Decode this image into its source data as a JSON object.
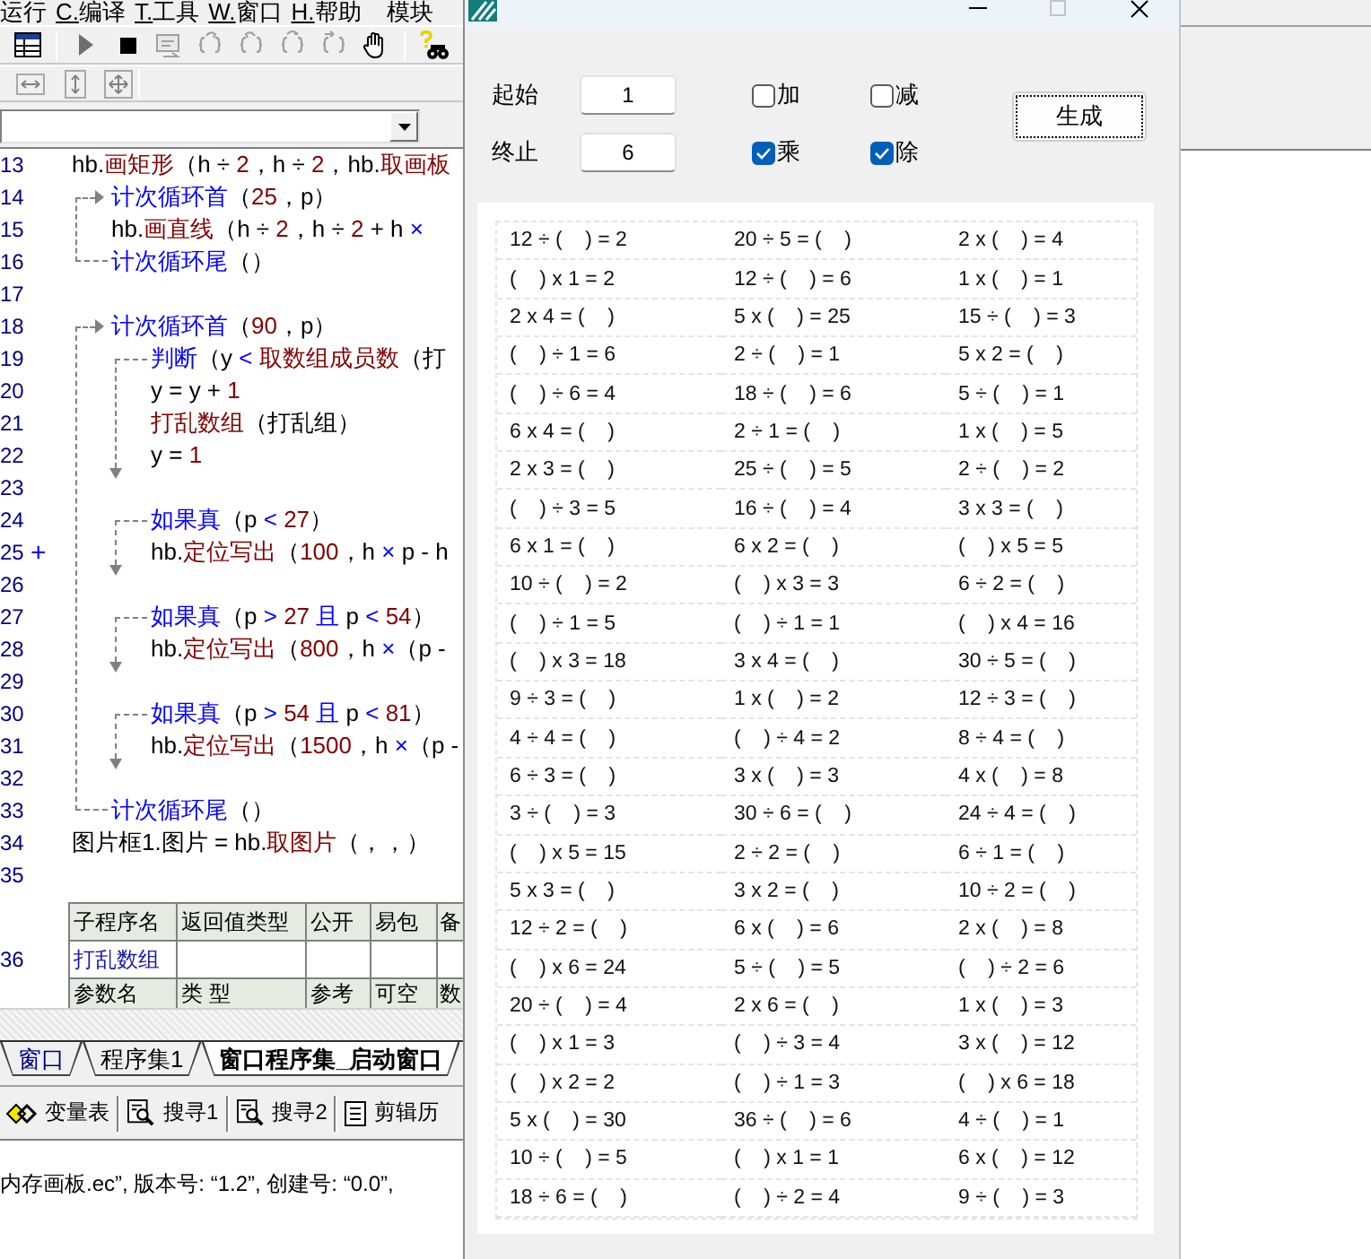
{
  "ide": {
    "menu": [
      {
        "label": "运行",
        "mnemonic": false
      },
      {
        "label": "C.编译",
        "mnemonic": true
      },
      {
        "label": "T.工具",
        "mnemonic": true
      },
      {
        "label": "W.窗口",
        "mnemonic": true
      },
      {
        "label": "H.帮助",
        "mnemonic": true
      },
      {
        "label": "模块",
        "mnemonic": false
      }
    ],
    "code": [
      {
        "kind": "line",
        "number": "13",
        "tokens": [
          {
            "text": "hb.",
            "kind": "plain"
          },
          {
            "text": "画矩形",
            "kind": "command"
          },
          {
            "text": "（h ÷ ",
            "kind": "plain"
          },
          {
            "text": "2",
            "kind": "number"
          },
          {
            "text": "，h ÷ ",
            "kind": "plain"
          },
          {
            "text": "2",
            "kind": "number"
          },
          {
            "text": "，hb.",
            "kind": "plain"
          },
          {
            "text": "取画板",
            "kind": "command"
          }
        ]
      },
      {
        "kind": "loop",
        "children": [
          {
            "kind": "line",
            "number": "14",
            "tokens": [
              {
                "text": "计次循环首",
                "kind": "keyword"
              },
              {
                "text": "（",
                "kind": "plain"
              },
              {
                "text": "25",
                "kind": "number"
              },
              {
                "text": "，p）",
                "kind": "plain"
              }
            ]
          },
          {
            "kind": "line",
            "number": "15",
            "tokens": [
              {
                "text": "hb.",
                "kind": "plain"
              },
              {
                "text": "画直线",
                "kind": "command"
              },
              {
                "text": "（h ÷ ",
                "kind": "plain"
              },
              {
                "text": "2",
                "kind": "number"
              },
              {
                "text": "，h ÷ ",
                "kind": "plain"
              },
              {
                "text": "2",
                "kind": "number"
              },
              {
                "text": " + h ",
                "kind": "plain"
              },
              {
                "text": "×",
                "kind": "keyword"
              }
            ]
          },
          {
            "kind": "line",
            "number": "16",
            "tokens": [
              {
                "text": "计次循环尾",
                "kind": "keyword"
              },
              {
                "text": "（）",
                "kind": "plain"
              }
            ]
          }
        ]
      },
      {
        "kind": "line",
        "number": "17"
      },
      {
        "kind": "loop",
        "children": [
          {
            "kind": "line",
            "number": "18",
            "tokens": [
              {
                "text": "计次循环首",
                "kind": "keyword"
              },
              {
                "text": "（",
                "kind": "plain"
              },
              {
                "text": "90",
                "kind": "number"
              },
              {
                "text": "，p）",
                "kind": "plain"
              }
            ]
          },
          {
            "kind": "branch",
            "children": [
              {
                "kind": "line",
                "number": "19",
                "tokens": [
                  {
                    "text": "判断",
                    "kind": "keyword"
                  },
                  {
                    "text": "（y ",
                    "kind": "plain"
                  },
                  {
                    "text": "< ",
                    "kind": "keyword"
                  },
                  {
                    "text": "取数组成员数",
                    "kind": "command"
                  },
                  {
                    "text": "（打",
                    "kind": "plain"
                  }
                ]
              },
              {
                "kind": "line",
                "number": "20",
                "tokens": [
                  {
                    "text": "y = y + ",
                    "kind": "plain"
                  },
                  {
                    "text": "1",
                    "kind": "number"
                  }
                ]
              },
              {
                "kind": "line",
                "number": "21",
                "tokens": [
                  {
                    "text": "打乱数组",
                    "kind": "command"
                  },
                  {
                    "text": "（打乱组）",
                    "kind": "plain"
                  }
                ]
              },
              {
                "kind": "line",
                "number": "22",
                "tokens": [
                  {
                    "text": "y = ",
                    "kind": "plain"
                  },
                  {
                    "text": "1",
                    "kind": "number"
                  }
                ]
              }
            ]
          },
          {
            "kind": "line",
            "number": "23"
          },
          {
            "kind": "branch",
            "children": [
              {
                "kind": "line",
                "number": "24",
                "tokens": [
                  {
                    "text": "如果真",
                    "kind": "keyword"
                  },
                  {
                    "text": "（p ",
                    "kind": "plain"
                  },
                  {
                    "text": "< ",
                    "kind": "keyword"
                  },
                  {
                    "text": "27",
                    "kind": "number"
                  },
                  {
                    "text": "）",
                    "kind": "plain"
                  }
                ]
              },
              {
                "kind": "line",
                "number": "25",
                "marker": "+",
                "tokens": [
                  {
                    "text": "hb.",
                    "kind": "plain"
                  },
                  {
                    "text": "定位写出",
                    "kind": "command"
                  },
                  {
                    "text": "（",
                    "kind": "plain"
                  },
                  {
                    "text": "100",
                    "kind": "number"
                  },
                  {
                    "text": "，h ",
                    "kind": "plain"
                  },
                  {
                    "text": "×",
                    "kind": "keyword"
                  },
                  {
                    "text": " p - h",
                    "kind": "plain"
                  }
                ]
              }
            ]
          },
          {
            "kind": "line",
            "number": "26"
          },
          {
            "kind": "branch",
            "children": [
              {
                "kind": "line",
                "number": "27",
                "tokens": [
                  {
                    "text": "如果真",
                    "kind": "keyword"
                  },
                  {
                    "text": "（p ",
                    "kind": "plain"
                  },
                  {
                    "text": "> ",
                    "kind": "keyword"
                  },
                  {
                    "text": "27",
                    "kind": "number"
                  },
                  {
                    "text": " 且 ",
                    "kind": "keyword"
                  },
                  {
                    "text": "p ",
                    "kind": "plain"
                  },
                  {
                    "text": "< ",
                    "kind": "keyword"
                  },
                  {
                    "text": "54",
                    "kind": "number"
                  },
                  {
                    "text": "）",
                    "kind": "plain"
                  }
                ]
              },
              {
                "kind": "line",
                "number": "28",
                "tokens": [
                  {
                    "text": "hb.",
                    "kind": "plain"
                  },
                  {
                    "text": "定位写出",
                    "kind": "command"
                  },
                  {
                    "text": "（",
                    "kind": "plain"
                  },
                  {
                    "text": "800",
                    "kind": "number"
                  },
                  {
                    "text": "，h ",
                    "kind": "plain"
                  },
                  {
                    "text": "×",
                    "kind": "keyword"
                  },
                  {
                    "text": "（p -",
                    "kind": "plain"
                  }
                ]
              }
            ]
          },
          {
            "kind": "line",
            "number": "29"
          },
          {
            "kind": "branch",
            "children": [
              {
                "kind": "line",
                "number": "30",
                "tokens": [
                  {
                    "text": "如果真",
                    "kind": "keyword"
                  },
                  {
                    "text": "（p ",
                    "kind": "plain"
                  },
                  {
                    "text": "> ",
                    "kind": "keyword"
                  },
                  {
                    "text": "54",
                    "kind": "number"
                  },
                  {
                    "text": " 且 ",
                    "kind": "keyword"
                  },
                  {
                    "text": "p ",
                    "kind": "plain"
                  },
                  {
                    "text": "< ",
                    "kind": "keyword"
                  },
                  {
                    "text": "81",
                    "kind": "number"
                  },
                  {
                    "text": "）",
                    "kind": "plain"
                  }
                ]
              },
              {
                "kind": "line",
                "number": "31",
                "tokens": [
                  {
                    "text": "hb.",
                    "kind": "plain"
                  },
                  {
                    "text": "定位写出",
                    "kind": "command"
                  },
                  {
                    "text": "（",
                    "kind": "plain"
                  },
                  {
                    "text": "1500",
                    "kind": "number"
                  },
                  {
                    "text": "，h ",
                    "kind": "plain"
                  },
                  {
                    "text": "×",
                    "kind": "keyword"
                  },
                  {
                    "text": "（p -",
                    "kind": "plain"
                  }
                ]
              }
            ]
          },
          {
            "kind": "line",
            "number": "32"
          },
          {
            "kind": "line",
            "number": "33",
            "tokens": [
              {
                "text": "计次循环尾",
                "kind": "keyword"
              },
              {
                "text": "（）",
                "kind": "plain"
              }
            ]
          }
        ]
      },
      {
        "kind": "line",
        "number": "34",
        "tokens": [
          {
            "text": "图片框1.图片 = hb.",
            "kind": "plain"
          },
          {
            "text": "取图片",
            "kind": "command"
          },
          {
            "text": "（，，）",
            "kind": "plain"
          }
        ]
      },
      {
        "kind": "line",
        "number": "35"
      }
    ],
    "subroutine_table": {
      "line_number": "36",
      "columns": [
        "子程序名",
        "返回值类型",
        "公开",
        "易包",
        "备"
      ],
      "name": "打乱数组",
      "param_columns": [
        "参数名",
        "类 型",
        "参考",
        "可空",
        "数"
      ]
    },
    "editor_tabs": [
      {
        "label": "窗口",
        "kind": "window",
        "selected": false
      },
      {
        "label": "程序集1",
        "kind": "code",
        "selected": false
      },
      {
        "label": "窗口程序集_启动窗口",
        "kind": "code",
        "selected": true
      }
    ],
    "panel_tabs": [
      {
        "label": "变量表",
        "kind": "variables"
      },
      {
        "label": "搜寻1",
        "kind": "search"
      },
      {
        "label": "搜寻2",
        "kind": "search"
      },
      {
        "label": "剪辑历",
        "kind": "clipboard"
      }
    ],
    "output": "内存画板.ec”, 版本号: “1.2”, 创建号: “0.0”,"
  },
  "dialog": {
    "range": [
      {
        "label": "起始",
        "value": "1"
      },
      {
        "label": "终止",
        "value": "6"
      }
    ],
    "operations": [
      {
        "label": "加",
        "checked": false
      },
      {
        "label": "减",
        "checked": false
      },
      {
        "label": "乘",
        "checked": true
      },
      {
        "label": "除",
        "checked": true
      }
    ],
    "generate_button": {
      "label": "生成",
      "focused": true
    },
    "problems": [
      [
        "12 ÷ (    ) = 2",
        "20 ÷ 5 = (    )",
        "2 x (    ) = 4"
      ],
      [
        "(    ) x 1 = 2",
        "12 ÷ (    ) = 6",
        "1 x (    ) = 1"
      ],
      [
        "2 x 4 = (    )",
        "5 x (    ) = 25",
        "15 ÷ (    ) = 3"
      ],
      [
        "(    ) ÷ 1 = 6",
        "2 ÷ (    ) = 1",
        "5 x 2 = (    )"
      ],
      [
        "(    ) ÷ 6 = 4",
        "18 ÷ (    ) = 6",
        "5 ÷ (    ) = 1"
      ],
      [
        "6 x 4 = (    )",
        "2 ÷ 1 = (    )",
        "1 x (    ) = 5"
      ],
      [
        "2 x 3 = (    )",
        "25 ÷ (    ) = 5",
        "2 ÷ (    ) = 2"
      ],
      [
        "(    ) ÷ 3 = 5",
        "16 ÷ (    ) = 4",
        "3 x 3 = (    )"
      ],
      [
        "6 x 1 = (    )",
        "6 x 2 = (    )",
        "(    ) x 5 = 5"
      ],
      [
        "10 ÷ (    ) = 2",
        "(    ) x 3 = 3",
        "6 ÷ 2 = (    )"
      ],
      [
        "(    ) ÷ 1 = 5",
        "(    ) ÷ 1 = 1",
        "(    ) x 4 = 16"
      ],
      [
        "(    ) x 3 = 18",
        "3 x 4 = (    )",
        "30 ÷ 5 = (    )"
      ],
      [
        "9 ÷ 3 = (    )",
        "1 x (    ) = 2",
        "12 ÷ 3 = (    )"
      ],
      [
        "4 ÷ 4 = (    )",
        "(    ) ÷ 4 = 2",
        "8 ÷ 4 = (    )"
      ],
      [
        "6 ÷ 3 = (    )",
        "3 x (    ) = 3",
        "4 x (    ) = 8"
      ],
      [
        "3 ÷ (    ) = 3",
        "30 ÷ 6 = (    )",
        "24 ÷ 4 = (    )"
      ],
      [
        "(    ) x 5 = 15",
        "2 ÷ 2 = (    )",
        "6 ÷ 1 = (    )"
      ],
      [
        "5 x 3 = (    )",
        "3 x 2 = (    )",
        "10 ÷ 2 = (    )"
      ],
      [
        "12 ÷ 2 = (    )",
        "6 x (    ) = 6",
        "2 x (    ) = 8"
      ],
      [
        "(    ) x 6 = 24",
        "5 ÷ (    ) = 5",
        "(    ) ÷ 2 = 6"
      ],
      [
        "20 ÷ (    ) = 4",
        "2 x 6 = (    )",
        "1 x (    ) = 3"
      ],
      [
        "(    ) x 1 = 3",
        "(    ) ÷ 3 = 4",
        "3 x (    ) = 12"
      ],
      [
        "(    ) x 2 = 2",
        "(    ) ÷ 1 = 3",
        "(    ) x 6 = 18"
      ],
      [
        "5 x (    ) = 30",
        "36 ÷ (    ) = 6",
        "4 ÷ (    ) = 1"
      ],
      [
        "10 ÷ (    ) = 5",
        "(    ) x 1 = 1",
        "6 x (    ) = 12"
      ],
      [
        "18 ÷ 6 = (    )",
        "(    ) ÷ 2 = 4",
        "9 ÷ (    ) = 3"
      ]
    ]
  }
}
